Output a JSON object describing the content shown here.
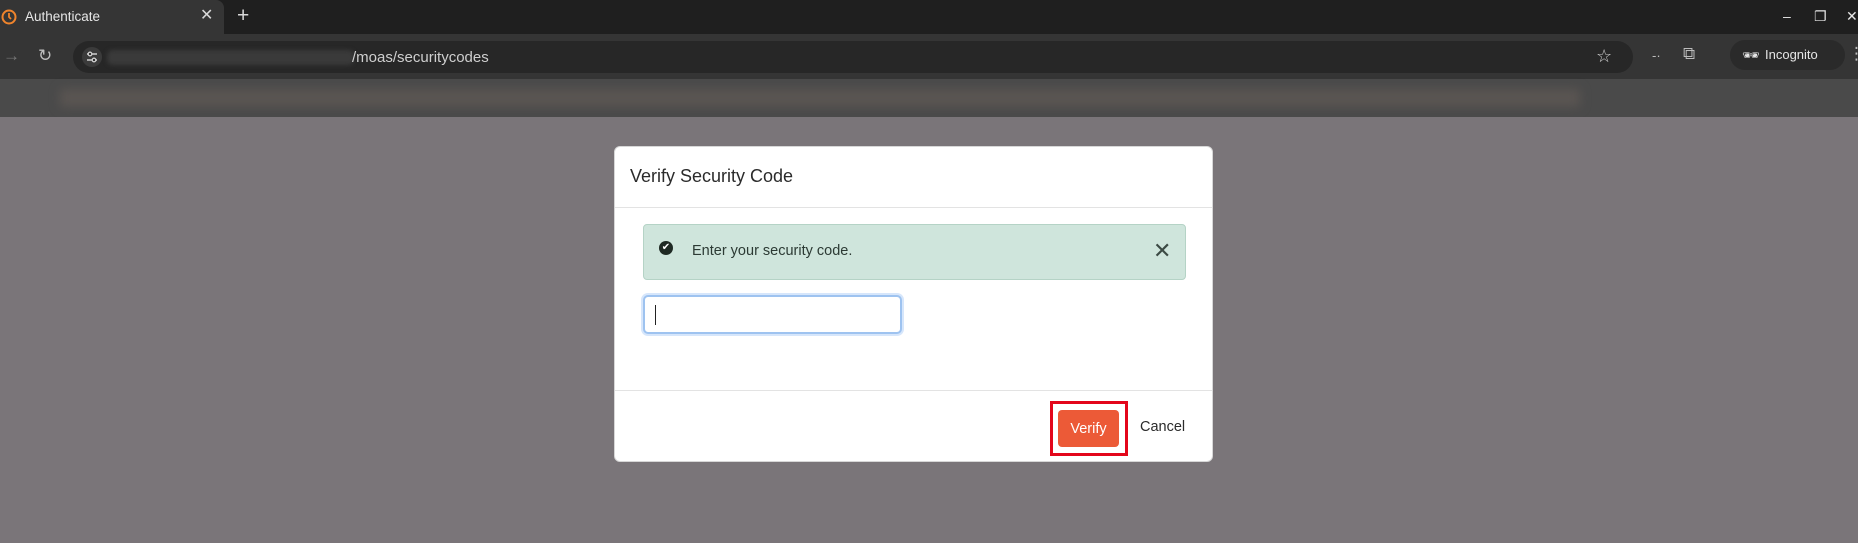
{
  "browser": {
    "tab_title": "Authenticate",
    "tab_close": "✕",
    "new_tab": "+",
    "url": "/moas/securitycodes",
    "incognito_label": "Incognito",
    "win_min": "–",
    "win_restore": "❐",
    "win_close": "✕"
  },
  "modal": {
    "title": "Verify Security Code",
    "alert_text": "Enter your security code.",
    "alert_close": "✕",
    "input_value": "",
    "verify_label": "Verify",
    "cancel_label": "Cancel"
  },
  "colors": {
    "accent": "#ec5a37",
    "alert_bg": "#cfe5dc",
    "highlight": "#e3061b"
  }
}
